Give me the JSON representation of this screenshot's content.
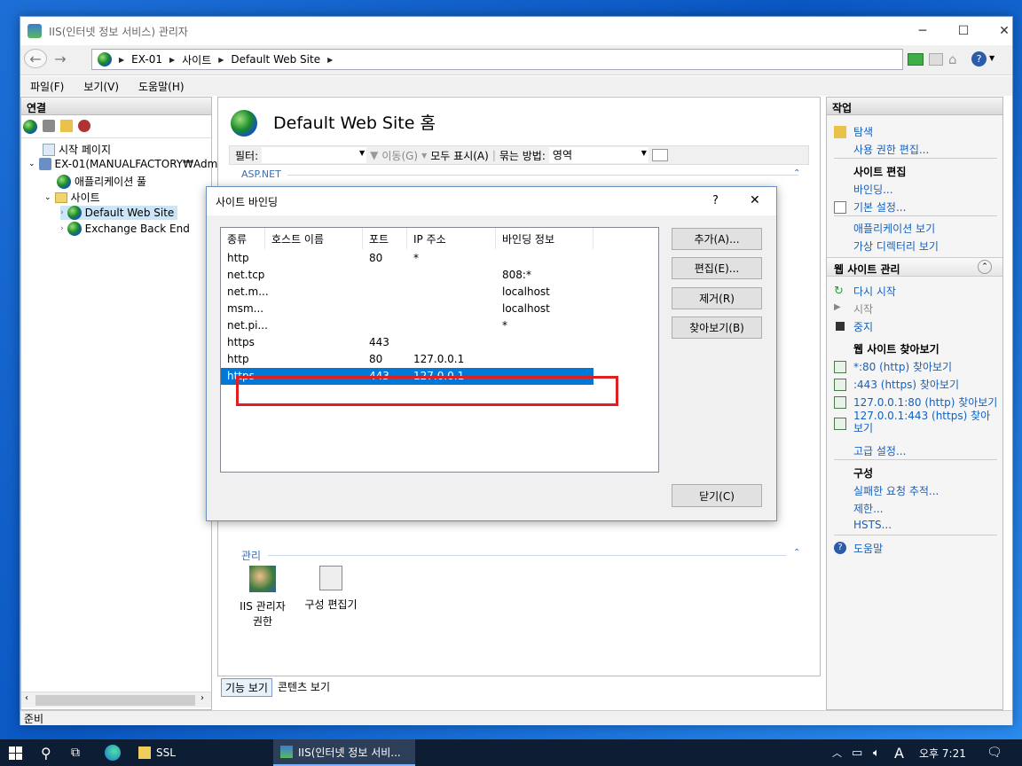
{
  "window": {
    "title": "IIS(인터넷 정보 서비스) 관리자"
  },
  "address": {
    "crumbs": [
      "EX-01",
      "사이트",
      "Default Web Site"
    ]
  },
  "menu": [
    "파일(F)",
    "보기(V)",
    "도움말(H)"
  ],
  "left": {
    "header": "연결",
    "tree": [
      "시작 페이지",
      "EX-01(MANUALFACTORY₩Adm",
      "애플리케이션 풀",
      "사이트",
      "Default Web Site",
      "Exchange Back End"
    ]
  },
  "center": {
    "title": "Default Web Site 홈",
    "filter_label": "필터:",
    "go": "이동(G)",
    "show_all": "모두 표시(A)",
    "group_label": "묶는 방법:",
    "group_value": "영역",
    "section_aspnet": "ASP.NET",
    "section_manage": "관리",
    "manage_items": [
      "IIS 관리자 권한",
      "구성 편집기"
    ],
    "tab_features": "기능 보기",
    "tab_content": "콘텐츠 보기"
  },
  "dialog": {
    "title": "사이트 바인딩",
    "help": "?",
    "close": "✕",
    "columns": [
      "종류",
      "호스트 이름",
      "포트",
      "IP 주소",
      "바인딩 정보"
    ],
    "rows": [
      [
        "http",
        "",
        "80",
        "*",
        ""
      ],
      [
        "net.tcp",
        "",
        "",
        "",
        "808:*"
      ],
      [
        "net.m...",
        "",
        "",
        "",
        "localhost"
      ],
      [
        "msm...",
        "",
        "",
        "",
        "localhost"
      ],
      [
        "net.pi...",
        "",
        "",
        "",
        "*"
      ],
      [
        "https",
        "",
        "443",
        "",
        ""
      ],
      [
        "http",
        "",
        "80",
        "127.0.0.1",
        ""
      ],
      [
        "https",
        "",
        "443",
        "127.0.0.1",
        ""
      ]
    ],
    "selected_row": 7,
    "buttons": {
      "add": "추가(A)...",
      "edit": "편집(E)...",
      "remove": "제거(R)",
      "browse": "찾아보기(B)",
      "close": "닫기(C)"
    }
  },
  "right": {
    "header": "작업",
    "explore": "탐색",
    "edit_perm": "사용 권한 편집...",
    "site_edit": "사이트 편집",
    "bindings": "바인딩...",
    "basic": "기본 설정...",
    "view_apps": "애플리케이션 보기",
    "view_vdirs": "가상 디렉터리 보기",
    "manage": "웹 사이트 관리",
    "restart": "다시 시작",
    "start": "시작",
    "stop": "중지",
    "browse_h": "웹 사이트 찾아보기",
    "browse_links": [
      "*:80 (http) 찾아보기",
      ":443 (https) 찾아보기",
      "127.0.0.1:80 (http) 찾아보기",
      "127.0.0.1:443 (https) 찾아보기"
    ],
    "advanced": "고급 설정...",
    "config": "구성",
    "failed": "실패한 요청 추적...",
    "limits": "제한...",
    "hsts": "HSTS...",
    "help": "도움말"
  },
  "status": "준비",
  "taskbar": {
    "ssl": "SSL",
    "iis": "IIS(인터넷 정보 서비...",
    "ime": "A",
    "time": "오후 7:21"
  }
}
